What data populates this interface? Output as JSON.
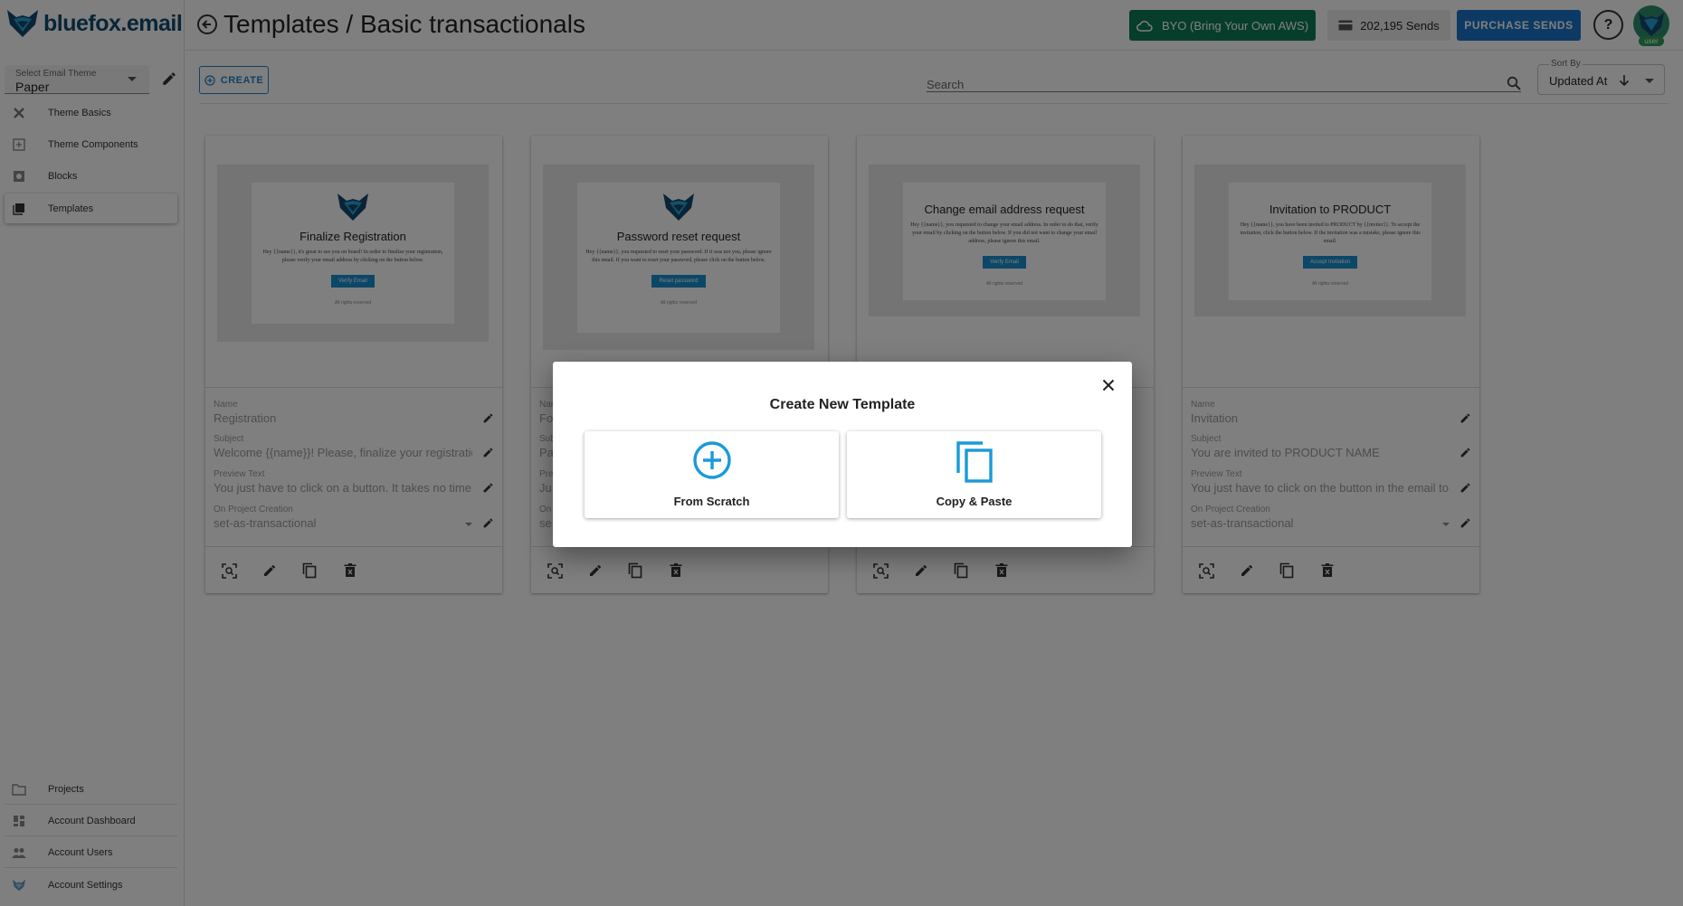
{
  "app": {
    "logo_text": "bluefox.email"
  },
  "sidebar": {
    "theme_select": {
      "label": "Select Email Theme",
      "value": "Paper"
    },
    "items": [
      {
        "label": "Theme Basics",
        "icon": "tools-icon"
      },
      {
        "label": "Theme Components",
        "icon": "components-icon"
      },
      {
        "label": "Blocks",
        "icon": "blocks-icon"
      },
      {
        "label": "Templates",
        "icon": "templates-icon",
        "active": true
      }
    ],
    "bottom_items": [
      {
        "label": "Projects",
        "icon": "folder-icon"
      },
      {
        "label": "Account Dashboard",
        "icon": "dashboard-icon"
      },
      {
        "label": "Account Users",
        "icon": "users-icon"
      },
      {
        "label": "Account Settings",
        "icon": "settings-icon"
      }
    ]
  },
  "header": {
    "title": "Templates / Basic transactionals",
    "byo_label": "BYO (Bring Your Own AWS)",
    "sends_label": "202,195 Sends",
    "purchase_label": "PURCHASE SENDS",
    "help_label": "?",
    "avatar_badge": "user"
  },
  "toolbar": {
    "create_label": "CREATE",
    "search_placeholder": "Search",
    "sort_label": "Sort By",
    "sort_value": "Updated At"
  },
  "fields_labels": {
    "name": "Name",
    "subject": "Subject",
    "preview": "Preview Text",
    "on_create": "On Project Creation"
  },
  "cards": [
    {
      "preview": {
        "title": "Finalize Registration",
        "body": "Hey {{name}}, it's great to see you on board! In order to finalize your registration, please verify your email address by clicking on the button below.",
        "button": "Verify Email",
        "footer": "All rights reserved"
      },
      "name": "Registration",
      "subject": "Welcome {{name}}! Please, finalize your registration",
      "preview_text": "You just have to click on a button. It takes no time",
      "on_create": "set-as-transactional"
    },
    {
      "preview": {
        "title": "Password reset request",
        "body": "Hey {{name}}, you requested to reset your password. If it was not you, please ignore this email. If you want to reset your password, please click on the button below.",
        "button": "Reset password",
        "footer": "All rights reserved"
      },
      "name": "Fo",
      "subject": "Pa",
      "preview_text": "Ju",
      "on_create": "se"
    },
    {
      "preview": {
        "title": "Change email address request",
        "body": "Hey {{name}}, you requested to change your email address. In order to do that, verify your email by clicking on the button below. If you did not want to change your email address, please ignore this email.",
        "button": "Verify Email",
        "footer": "All rights reserved"
      }
    },
    {
      "preview": {
        "title": "Invitation to PRODUCT",
        "body": "Hey {{name}}, you have been invited to PRODUCT by {{inviter}}. To accept the invitation, click the button below. If the invitation was a mistake, please ignore this email.",
        "button": "Accept Invitation",
        "footer": "All rights reserved"
      },
      "name": "Invitation",
      "subject": "You are invited to PRODUCT NAME",
      "preview_text": "You just have to click on the button in the email to",
      "on_create": "set-as-transactional"
    }
  ],
  "modal": {
    "title": "Create New Template",
    "options": [
      {
        "label": "From Scratch",
        "icon": "add-circle-icon"
      },
      {
        "label": "Copy & Paste",
        "icon": "copy-icon"
      }
    ]
  },
  "colors": {
    "accent": "#1c85c9",
    "byo_green": "#0f7d56",
    "purchase_blue": "#1875c8"
  }
}
